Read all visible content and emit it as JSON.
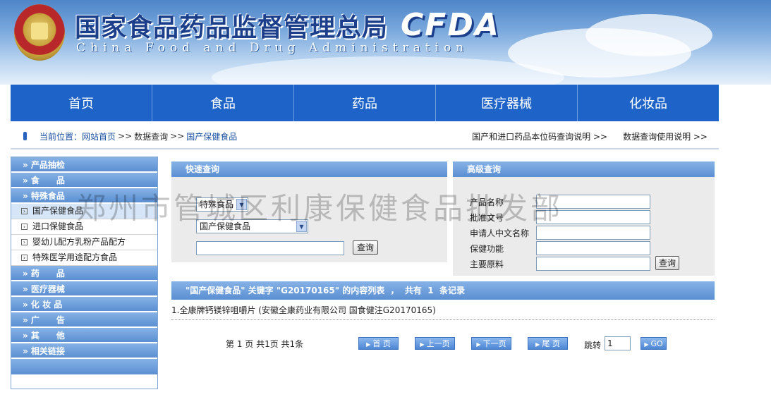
{
  "header": {
    "title_cn": "国家食品药品监督管理总局",
    "title_en": "China Food and Drug Administration",
    "logo_text": "CFDA",
    "emblem": "national-emblem-icon"
  },
  "nav": [
    "首页",
    "食品",
    "药品",
    "医疗器械",
    "化妆品"
  ],
  "breadcrumb": {
    "label": "当前位置：",
    "items": [
      "网站首页",
      "数据查询",
      "国产保健食品"
    ],
    "separator": ">>",
    "right_links": [
      "国产和进口药品本位码查询说明 >>",
      "数据查询使用说明 >>"
    ]
  },
  "sidebar": {
    "sections": [
      {
        "label": "» 产品抽检"
      },
      {
        "label": "» 食　　品"
      },
      {
        "label": "» 特殊食品"
      }
    ],
    "sub_items": [
      "国产保健食品",
      "进口保健食品",
      "婴幼儿配方乳粉产品配方",
      "特殊医学用途配方食品"
    ],
    "sections2": [
      {
        "label": "» 药　　品"
      },
      {
        "label": "» 医疗器械"
      },
      {
        "label": "» 化 妆 品"
      },
      {
        "label": "» 广　　告"
      },
      {
        "label": "» 其　　他"
      },
      {
        "label": "» 相关链接"
      }
    ]
  },
  "quick_search": {
    "title": "快速查询",
    "select1": "特殊食品",
    "select2": "国产保健食品",
    "input_value": "",
    "button": "查询"
  },
  "advanced_search": {
    "title": "高级查询",
    "fields": [
      "产品名称",
      "批准文号",
      "申请人中文名称",
      "保健功能",
      "主要原料"
    ],
    "button": "查询"
  },
  "watermark": "郑州市管城区利康保健食品批发部",
  "results": {
    "header": "\"国产保健食品\" 关键字 \"G20170165\" 的内容列表  ，  共有  1  条记录",
    "items": [
      "1.全康牌钙镁锌咀嚼片  (安徽全康药业有限公司  国食健注G20170165)"
    ]
  },
  "pagination": {
    "info": "第  1  页  共1页  共1条",
    "buttons": [
      "首 页",
      "上一页",
      "下一页",
      "尾 页"
    ],
    "jump_label": "跳转",
    "jump_value": "1",
    "go": "GO"
  },
  "colors": {
    "nav_bg": "#1e64c8",
    "panel_header": "#5b8fd2",
    "title_blue": "#1c3f8c"
  }
}
